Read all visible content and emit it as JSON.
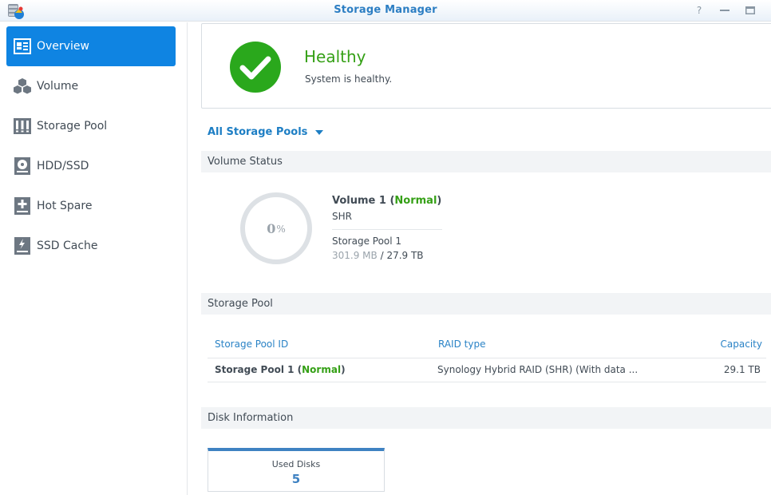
{
  "window": {
    "title": "Storage Manager",
    "controls": {
      "help": "?",
      "minimize": "—",
      "maximize": "▭"
    }
  },
  "sidebar": {
    "items": [
      {
        "label": "Overview",
        "icon": "overview-icon",
        "active": true
      },
      {
        "label": "Volume",
        "icon": "volume-icon",
        "active": false
      },
      {
        "label": "Storage Pool",
        "icon": "storage-pool-icon",
        "active": false
      },
      {
        "label": "HDD/SSD",
        "icon": "hdd-icon",
        "active": false
      },
      {
        "label": "Hot Spare",
        "icon": "hot-spare-icon",
        "active": false
      },
      {
        "label": "SSD Cache",
        "icon": "ssd-cache-icon",
        "active": false
      }
    ]
  },
  "health": {
    "status": "Healthy",
    "description": "System is healthy.",
    "color": "#35a016"
  },
  "pool_selector": {
    "label": "All Storage Pools"
  },
  "volume_status": {
    "header": "Volume Status",
    "usage_percent": 0,
    "usage_num": "0",
    "usage_unit": "%",
    "volume_name": "Volume 1",
    "volume_state": "Normal",
    "open_paren": " (",
    "close_paren": ")",
    "raid": "SHR",
    "pool": "Storage Pool 1",
    "used": "301.9 MB",
    "separator": " / ",
    "total": "27.9 TB"
  },
  "storage_pool": {
    "header": "Storage Pool",
    "columns": [
      "Storage Pool ID",
      "RAID type",
      "Capacity"
    ],
    "rows": [
      {
        "id": "Storage Pool 1",
        "state": "Normal",
        "raid": "Synology Hybrid RAID (SHR) (With data ...",
        "capacity": "29.1 TB"
      }
    ]
  },
  "disk_info": {
    "header": "Disk Information",
    "used_disks_label": "Used Disks",
    "used_disks_value": "5"
  },
  "colors": {
    "accent": "#0f84e2",
    "link": "#2b83c6",
    "healthy": "#35a016"
  }
}
